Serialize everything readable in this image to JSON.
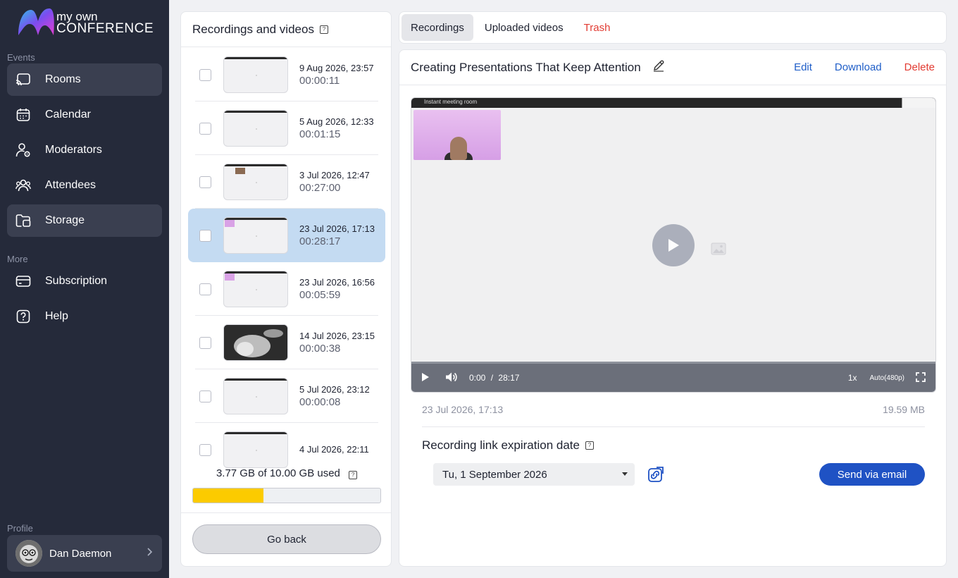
{
  "app": {
    "logo_line1": "my own",
    "logo_line2": "CONFERENCE"
  },
  "sidebar": {
    "section_events": "Events",
    "section_more": "More",
    "section_profile": "Profile",
    "items": [
      {
        "label": "Rooms",
        "icon": "cast-icon",
        "active": true
      },
      {
        "label": "Calendar",
        "icon": "calendar-icon",
        "active": false
      },
      {
        "label": "Moderators",
        "icon": "moderator-icon",
        "active": false
      },
      {
        "label": "Attendees",
        "icon": "attendees-icon",
        "active": false
      },
      {
        "label": "Storage",
        "icon": "folder-icon",
        "active": true
      }
    ],
    "more_items": [
      {
        "label": "Subscription",
        "icon": "card-icon"
      },
      {
        "label": "Help",
        "icon": "help-icon"
      }
    ],
    "profile": {
      "name": "Dan Daemon"
    }
  },
  "recordings_panel": {
    "title": "Recordings and videos",
    "items": [
      {
        "date": "9 Aug 2026, 23:57",
        "duration": "00:00:11",
        "selected": false
      },
      {
        "date": "5 Aug 2026, 12:33",
        "duration": "00:01:15",
        "selected": false
      },
      {
        "date": "3 Jul 2026, 12:47",
        "duration": "00:27:00",
        "selected": false
      },
      {
        "date": "23 Jul 2026, 17:13",
        "duration": "00:28:17",
        "selected": true
      },
      {
        "date": "23 Jul 2026, 16:56",
        "duration": "00:05:59",
        "selected": false
      },
      {
        "date": "14 Jul 2026, 23:15",
        "duration": "00:00:38",
        "selected": false
      },
      {
        "date": "5 Jul 2026, 23:12",
        "duration": "00:00:08",
        "selected": false
      },
      {
        "date": "4 Jul 2026, 22:11",
        "duration": "",
        "selected": false
      }
    ],
    "storage_text": "3.77 GB of 10.00 GB used",
    "storage_used_fraction": 0.377,
    "go_back_label": "Go back"
  },
  "tabs": [
    {
      "label": "Recordings",
      "active": true
    },
    {
      "label": "Uploaded videos",
      "active": false
    },
    {
      "label": "Trash",
      "active": false
    }
  ],
  "detail": {
    "title": "Creating Presentations That Keep Attention",
    "edit_label": "Edit",
    "download_label": "Download",
    "delete_label": "Delete",
    "video": {
      "room_title": "Instant meeting room",
      "current_time": "0:00",
      "separator": "/",
      "total_time": "28:17",
      "speed": "1x",
      "quality": "Auto(480p)"
    },
    "recorded_date": "23 Jul 2026, 17:13",
    "file_size": "19.59 MB",
    "expiration_label": "Recording link expiration date",
    "expiration_value": "Tu, 1 September 2026",
    "send_label": "Send via email"
  },
  "colors": {
    "sidebar_bg": "#252a3a",
    "accent_blue": "#1f52c4",
    "link_blue": "#1f5ec8",
    "danger_red": "#e23c33",
    "selected_bg": "#c4dbf2",
    "storage_fill": "#fccb00"
  }
}
